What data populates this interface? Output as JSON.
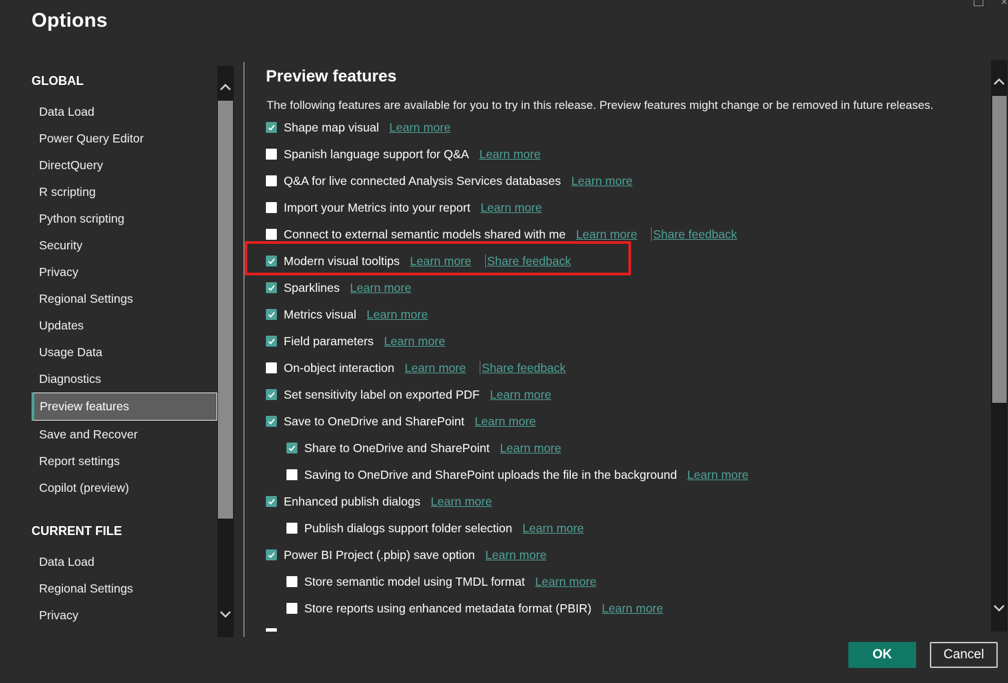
{
  "dialog": {
    "title": "Options"
  },
  "sidebar": {
    "global_heading": "GLOBAL",
    "global_items": [
      "Data Load",
      "Power Query Editor",
      "DirectQuery",
      "R scripting",
      "Python scripting",
      "Security",
      "Privacy",
      "Regional Settings",
      "Updates",
      "Usage Data",
      "Diagnostics",
      "Preview features",
      "Save and Recover",
      "Report settings",
      "Copilot (preview)"
    ],
    "selected_item": "Preview features",
    "current_heading": "CURRENT FILE",
    "current_items": [
      "Data Load",
      "Regional Settings",
      "Privacy"
    ]
  },
  "main": {
    "title": "Preview features",
    "description": "The following features are available for you to try in this release. Preview features might change or be removed in future releases.",
    "learn_more": "Learn more",
    "share_feedback": "Share feedback",
    "features": [
      {
        "label": "Shape map visual",
        "checked": true,
        "indent": 0
      },
      {
        "label": "Spanish language support for Q&A",
        "checked": false,
        "indent": 0
      },
      {
        "label": "Q&A for live connected Analysis Services databases",
        "checked": false,
        "indent": 0
      },
      {
        "label": "Import your Metrics into your report",
        "checked": false,
        "indent": 0
      },
      {
        "label": "Connect to external semantic models shared with me",
        "checked": false,
        "indent": 0,
        "feedback": true
      },
      {
        "label": "Modern visual tooltips",
        "checked": true,
        "indent": 0,
        "feedback": true,
        "highlighted": true
      },
      {
        "label": "Sparklines",
        "checked": true,
        "indent": 0
      },
      {
        "label": "Metrics visual",
        "checked": true,
        "indent": 0
      },
      {
        "label": "Field parameters",
        "checked": true,
        "indent": 0
      },
      {
        "label": "On-object interaction",
        "checked": false,
        "indent": 0,
        "feedback": true
      },
      {
        "label": "Set sensitivity label on exported PDF",
        "checked": true,
        "indent": 0
      },
      {
        "label": "Save to OneDrive and SharePoint",
        "checked": true,
        "indent": 0
      },
      {
        "label": "Share to OneDrive and SharePoint",
        "checked": true,
        "indent": 1
      },
      {
        "label": "Saving to OneDrive and SharePoint uploads the file in the background",
        "checked": false,
        "indent": 1
      },
      {
        "label": "Enhanced publish dialogs",
        "checked": true,
        "indent": 0
      },
      {
        "label": "Publish dialogs support folder selection",
        "checked": false,
        "indent": 1
      },
      {
        "label": "Power BI Project (.pbip) save option",
        "checked": true,
        "indent": 0
      },
      {
        "label": "Store semantic model using TMDL format",
        "checked": false,
        "indent": 1
      },
      {
        "label": "Store reports using enhanced metadata format (PBIR)",
        "checked": false,
        "indent": 1
      }
    ]
  },
  "buttons": {
    "ok": "OK",
    "cancel": "Cancel"
  },
  "colors": {
    "background": "#2b2b2b",
    "accent": "#4ea297",
    "ok_button": "#117865",
    "highlight_border": "#e0201f"
  }
}
